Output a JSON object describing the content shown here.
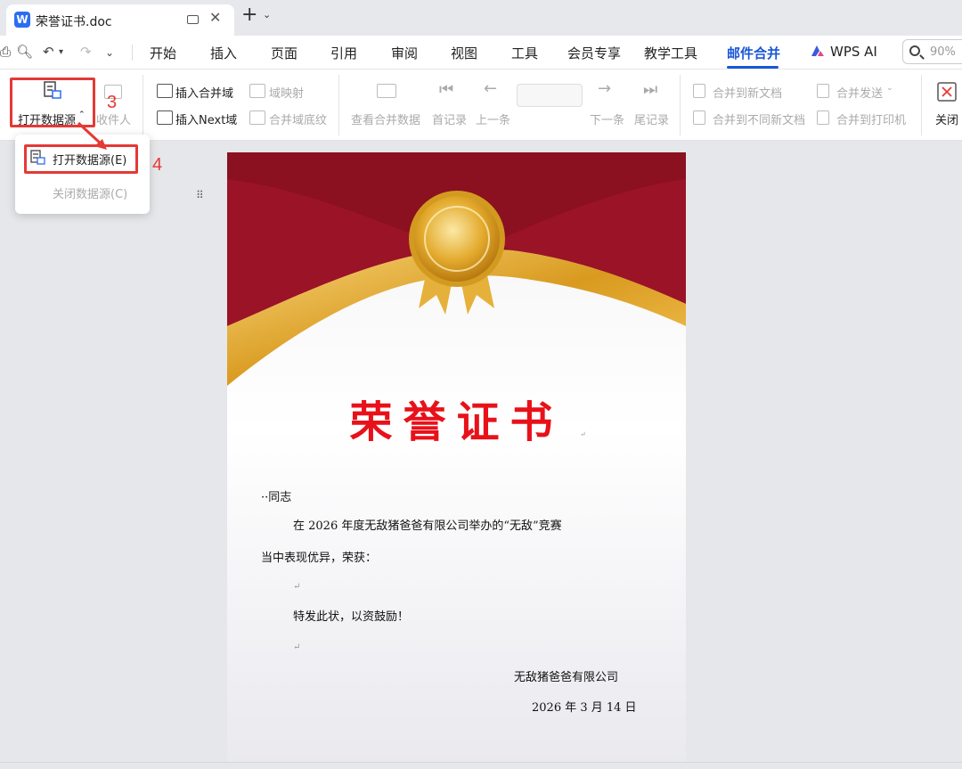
{
  "window": {
    "tab_title": "荣誉证书.doc",
    "new_tab_icon": "plus-icon",
    "app_logo": "W"
  },
  "menu": {
    "tabs": [
      "开始",
      "插入",
      "页面",
      "引用",
      "审阅",
      "视图",
      "工具",
      "会员专享",
      "教学工具",
      "邮件合并",
      "WPS AI"
    ],
    "active": "邮件合并",
    "zoom": "90%"
  },
  "ribbon": {
    "open_datasource": "打开数据源",
    "recipients": "收件人",
    "insert_merge_field": "插入合并域",
    "field_mapping": "域映射",
    "insert_next": "插入Next域",
    "merge_field_shading": "合并域底纹",
    "view_merged_data": "查看合并数据",
    "first_record": "首记录",
    "prev": "上一条",
    "next": "下一条",
    "last_record": "尾记录",
    "merge_new_doc": "合并到新文档",
    "merge_diff_docs": "合并到不同新文档",
    "merge_send": "合并发送",
    "merge_printer": "合并到打印机",
    "close": "关闭"
  },
  "dropdown": {
    "open": "打开数据源(E)",
    "close": "关闭数据源(C)"
  },
  "annotations": {
    "step3": "3",
    "step4": "4"
  },
  "certificate": {
    "title": "荣誉证书",
    "salutation": "··同志",
    "body1": "在 2026 年度无敌猪爸爸有限公司举办的“无敌”竞赛",
    "body2": "当中表现优异，荣获：",
    "body3": "特发此状，以资鼓励！",
    "signature": "无敌猪爸爸有限公司",
    "date": "2026 年 3 月 14 日"
  },
  "colors": {
    "accent": "#1a57d6",
    "annotation_red": "#e53935",
    "cert_red": "#e8111a",
    "ribbon_maroon": "#8b1020",
    "gold": "#e0a82a"
  }
}
